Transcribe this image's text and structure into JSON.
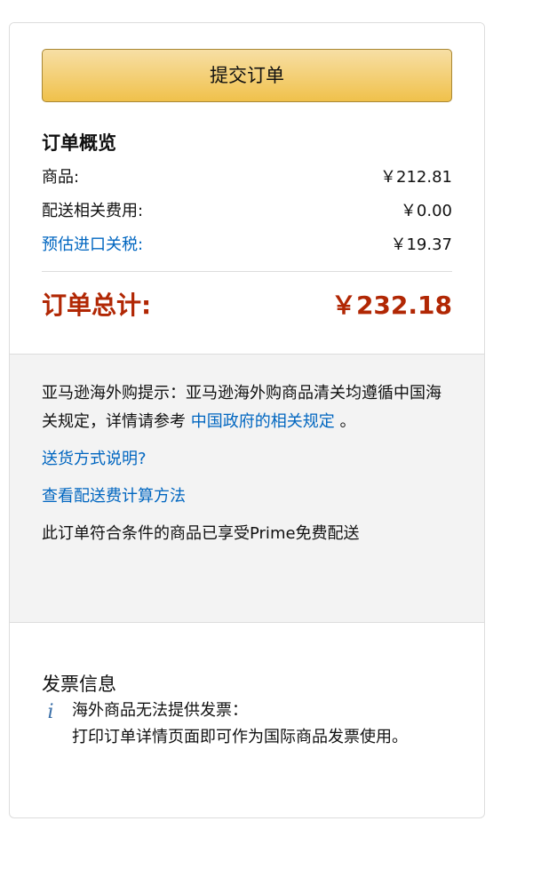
{
  "place_order": {
    "label": "提交订单"
  },
  "summary": {
    "title": "订单概览",
    "rows": [
      {
        "label": "商品:",
        "amount": "￥212.81",
        "link": false
      },
      {
        "label": "配送相关费用:",
        "amount": "￥0.00",
        "link": false
      },
      {
        "label": "预估进口关税:",
        "amount": "￥19.37",
        "link": true
      }
    ],
    "total_label": "订单总计:",
    "total_amount": "￥232.18"
  },
  "notice": {
    "prefix": "亚马逊海外购提示：亚马逊海外购商品清关均遵循中国海关规定，详情请参考 ",
    "regulation_link": "中国政府的相关规定",
    "suffix": " 。",
    "shipping_link": "送货方式说明?",
    "shipping_fee_link": "查看配送费计算方法",
    "prime_note": "此订单符合条件的商品已享受Prime免费配送"
  },
  "invoice": {
    "title": "发票信息",
    "icon": "info-icon",
    "line1": "海外商品无法提供发票：",
    "line2": "打印订单详情页面即可作为国际商品发票使用。"
  },
  "colors": {
    "accent_link": "#0066c0",
    "total_red": "#b12704",
    "button_gold": "#f0c14b"
  }
}
